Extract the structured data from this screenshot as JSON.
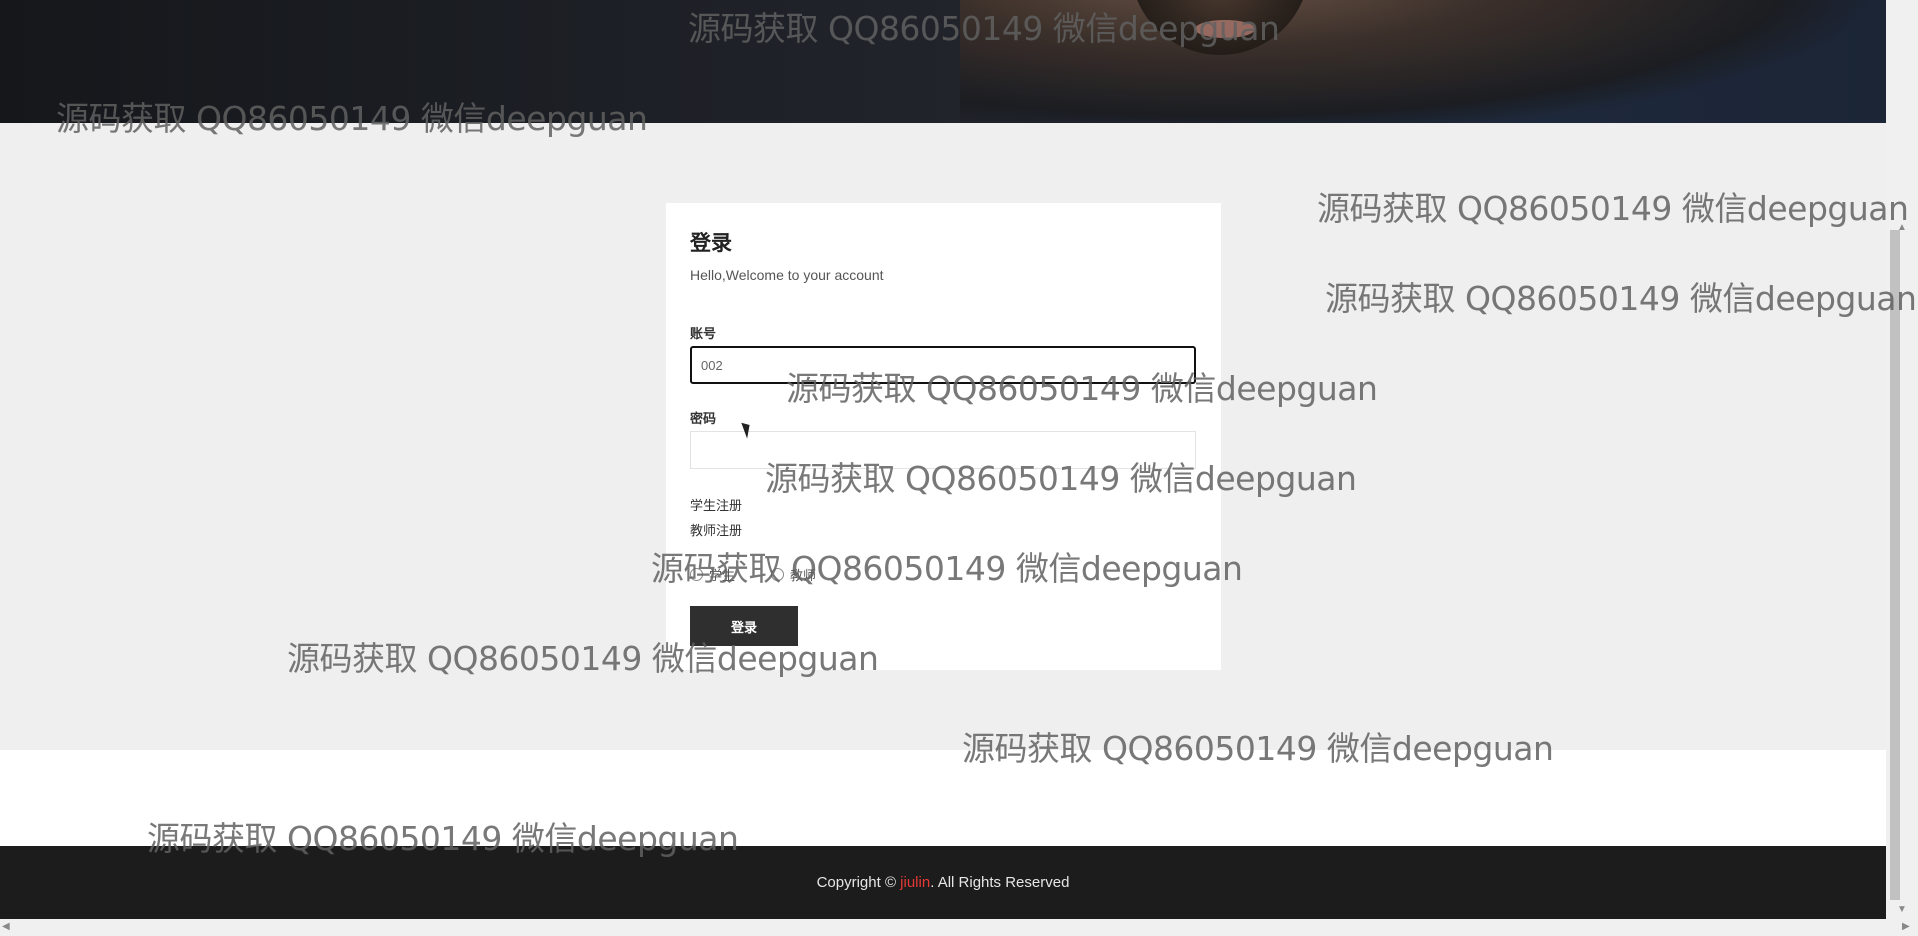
{
  "login": {
    "title": "登录",
    "subtitle": "Hello,Welcome to your account",
    "account_label": "账号",
    "account_value": "002",
    "password_label": "密码",
    "password_value": "",
    "student_register": "学生注册",
    "teacher_register": "教师注册",
    "role_options": [
      "学生",
      "教师"
    ],
    "submit_label": "登录"
  },
  "footer": {
    "prefix": "Copyright © ",
    "brand": "jiulin",
    "suffix": ". All Rights Reserved",
    "brand_color": "#e53935"
  },
  "watermark": {
    "text": "源码获取 QQ86050149 微信deepguan"
  }
}
